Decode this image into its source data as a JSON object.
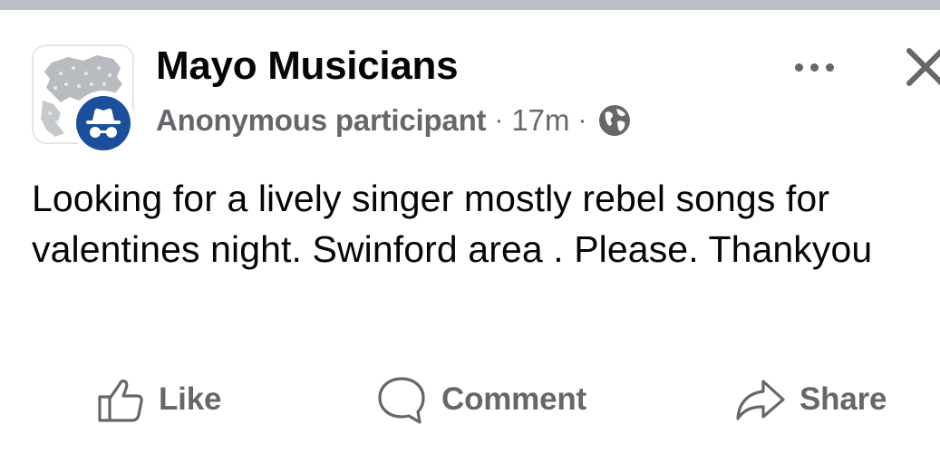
{
  "post": {
    "group_name": "Mayo Musicians",
    "author": "Anonymous participant",
    "separator": "·",
    "time": "17m",
    "audience_icon": "globe-icon",
    "text": "Looking for a lively singer mostly rebel songs for valentines night. Swinford area . Please. Thankyou"
  },
  "header_icons": {
    "more": "more-dots-icon",
    "close": "close-icon"
  },
  "badge_icon": "incognito-icon",
  "actions": [
    {
      "label": "Like",
      "icon": "thumbs-up-icon"
    },
    {
      "label": "Comment",
      "icon": "comment-bubble-icon"
    },
    {
      "label": "Share",
      "icon": "share-arrow-icon"
    }
  ],
  "colors": {
    "primary_text": "#050505",
    "secondary_text": "#65676b",
    "badge_blue": "#1b4f9c",
    "divider": "#bcbfc4"
  }
}
